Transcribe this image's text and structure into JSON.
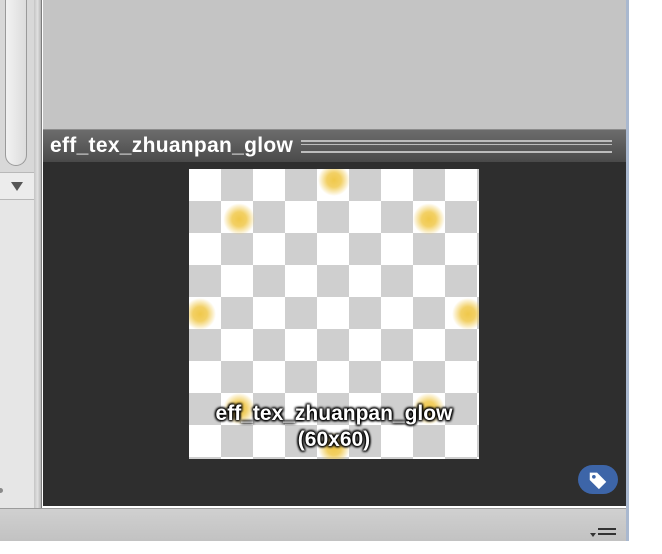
{
  "panel": {
    "title": "eff_tex_zhuanpan_glow"
  },
  "preview": {
    "caption_name": "eff_tex_zhuanpan_glow",
    "caption_size": "(60x60)",
    "glow_color": "#f0c84a",
    "checker_dark": "#cfcfcf",
    "checker_light": "#ffffff"
  },
  "colors": {
    "viewport_bg": "#2e2e2e",
    "header_bg": "#555555",
    "tag_button": "#3d65a8",
    "top_area": "#c4c4c4"
  },
  "icons": {
    "scroll_down": "triangle-down-icon",
    "tag": "tag-icon",
    "resize": "resize-grip-icon"
  }
}
